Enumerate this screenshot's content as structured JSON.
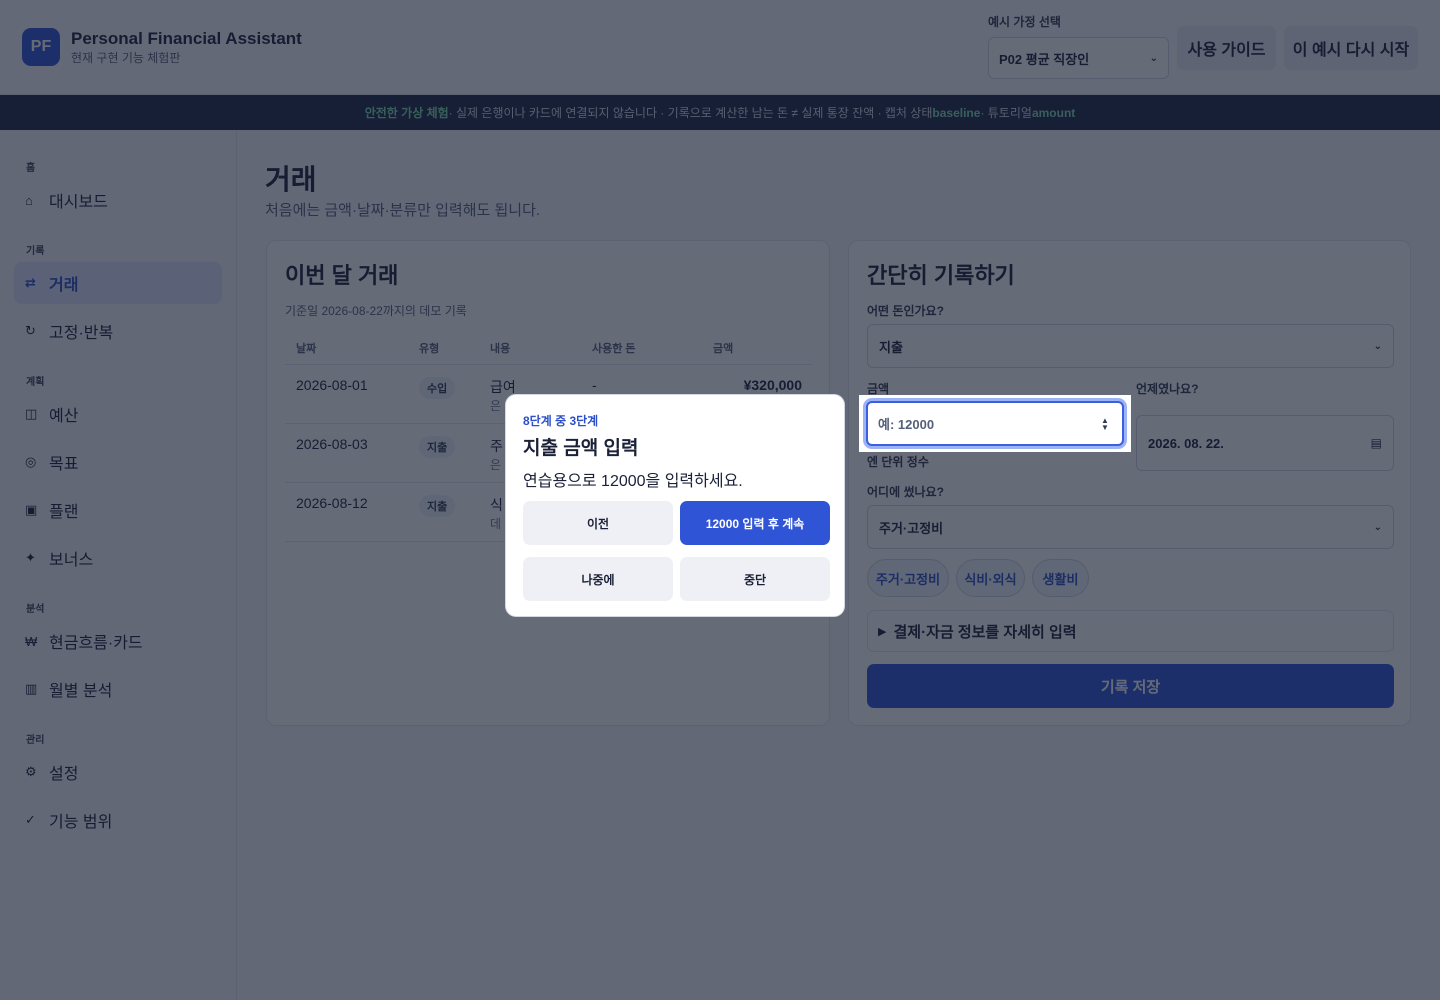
{
  "header": {
    "logo": "PF",
    "title": "Personal Financial Assistant",
    "subtitle": "현재 구현 기능 체험판",
    "household_label": "예시 가정 선택",
    "household_value": "P02 평균 직장인",
    "guide_button": "사용 가이드",
    "restart_button": "이 예시 다시 시작"
  },
  "banner": {
    "highlight": "안전한 가상 체험",
    "text1": " · 실제 은행이나 카드에 연결되지 않습니다 · 기록으로 계산한 남는 돈 ≠ 실제 통장 잔액 · 캡처 상태 ",
    "state": "baseline",
    "text2": " · 튜토리얼 ",
    "tutorial": "amount"
  },
  "sidebar": {
    "sections": [
      "홈",
      "기록",
      "계획",
      "분석",
      "관리"
    ],
    "items": [
      {
        "label": "대시보드",
        "icon": "⌂"
      },
      {
        "label": "거래",
        "icon": "⇄"
      },
      {
        "label": "고정·반복",
        "icon": "↻"
      },
      {
        "label": "예산",
        "icon": "◫"
      },
      {
        "label": "목표",
        "icon": "◎"
      },
      {
        "label": "플랜",
        "icon": "▣"
      },
      {
        "label": "보너스",
        "icon": "✦"
      },
      {
        "label": "현금흐름·카드",
        "icon": "₩"
      },
      {
        "label": "월별 분석",
        "icon": "▥"
      },
      {
        "label": "설정",
        "icon": "⚙"
      },
      {
        "label": "기능 범위",
        "icon": "✓"
      }
    ]
  },
  "main": {
    "title": "거래",
    "subtitle": "처음에는 금액·날짜·분류만 입력해도 됩니다."
  },
  "tx_card": {
    "title": "이번 달 거래",
    "note": "기준일 2026-08-22까지의 데모 기록",
    "columns": [
      "날짜",
      "유형",
      "내용",
      "사용한 돈",
      "금액"
    ],
    "rows": [
      {
        "date": "2026-08-01",
        "type": "수입",
        "content": "급여",
        "sub": "은",
        "spent": "-",
        "amount": "¥320,000"
      },
      {
        "date": "2026-08-03",
        "type": "지출",
        "content": "주",
        "sub": "은"
      },
      {
        "date": "2026-08-12",
        "type": "지출",
        "content": "식",
        "sub": "데"
      }
    ]
  },
  "form": {
    "title": "간단히 기록하기",
    "kind_label": "어떤 돈인가요?",
    "kind_value": "지출",
    "amount_label": "금액",
    "amount_placeholder": "예: 12000",
    "amount_hint": "엔 단위 정수",
    "date_label": "언제였나요?",
    "date_value": "2026. 08. 22.",
    "category_label": "어디에 썼나요?",
    "category_value": "주거·고정비",
    "chips": [
      "주거·고정비",
      "식비·외식",
      "생활비"
    ],
    "details_label": "결제·자금 정보를 자세히 입력",
    "save_label": "기록 저장"
  },
  "tutorial": {
    "step": "8단계 중 3단계",
    "title": "지출 금액 입력",
    "description": "연습용으로 12000을 입력하세요.",
    "prev": "이전",
    "next": "12000 입력 후 계속",
    "later": "나중에",
    "stop": "중단"
  },
  "colors": {
    "accent": "#2f54d6",
    "banner_bg": "#1b2540",
    "banner_highlight": "#7fdcae"
  }
}
